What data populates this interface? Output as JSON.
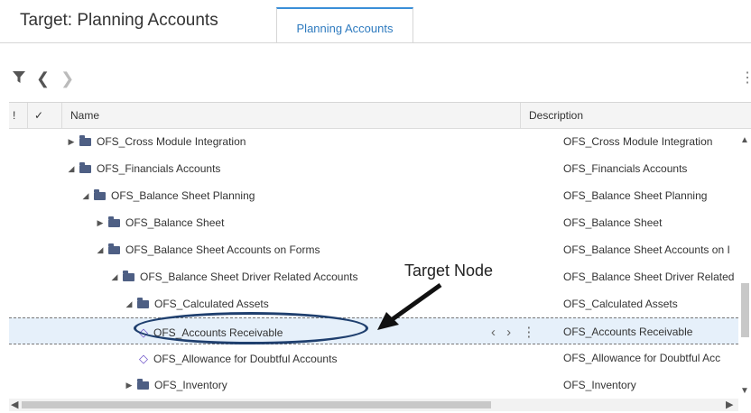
{
  "header": {
    "title": "Target: Planning Accounts"
  },
  "tabs": [
    {
      "label": "Planning Accounts",
      "active": true
    }
  ],
  "toolbar": {
    "filter_icon": "filter-icon",
    "back_icon": "chevron-left-icon",
    "forward_icon": "chevron-right-icon",
    "menu_icon": "kebab-icon"
  },
  "grid": {
    "columns": {
      "flag": "!",
      "check": "✓",
      "name": "Name",
      "description": "Description"
    },
    "rows": [
      {
        "name": "OFS_Cross Module Integration",
        "description": "OFS_Cross Module Integration",
        "level": 1,
        "expanded": false,
        "type": "folder"
      },
      {
        "name": "OFS_Financials Accounts",
        "description": "OFS_Financials Accounts",
        "level": 1,
        "expanded": true,
        "type": "folder"
      },
      {
        "name": "OFS_Balance Sheet Planning",
        "description": "OFS_Balance Sheet Planning",
        "level": 2,
        "expanded": true,
        "type": "folder"
      },
      {
        "name": "OFS_Balance Sheet",
        "description": "OFS_Balance Sheet",
        "level": 3,
        "expanded": false,
        "type": "folder"
      },
      {
        "name": "OFS_Balance Sheet Accounts on Forms",
        "description": "OFS_Balance Sheet Accounts on I",
        "level": 3,
        "expanded": true,
        "type": "folder"
      },
      {
        "name": "OFS_Balance Sheet Driver Related Accounts",
        "description": "OFS_Balance Sheet Driver Related",
        "level": 4,
        "expanded": true,
        "type": "folder"
      },
      {
        "name": "OFS_Calculated Assets",
        "description": "OFS_Calculated Assets",
        "level": 5,
        "expanded": true,
        "type": "folder"
      },
      {
        "name": "OFS_Accounts Receivable",
        "description": "OFS_Accounts Receivable",
        "level": 6,
        "type": "member",
        "selected": true
      },
      {
        "name": "OFS_Allowance for Doubtful Accounts",
        "description": "OFS_Allowance for Doubtful Acc",
        "level": 6,
        "type": "member"
      },
      {
        "name": "OFS_Inventory",
        "description": "OFS_Inventory",
        "level": 5,
        "expanded": false,
        "type": "folder"
      }
    ],
    "row_actions": "‹ › ⋮"
  },
  "annotation": {
    "callout": "Target Node"
  },
  "colors": {
    "accent": "#3a8fd8",
    "folder": "#4e5f84",
    "member": "#6a4fc8",
    "selected_bg": "#e6f0fa",
    "annotation": "#1f3f6e"
  }
}
